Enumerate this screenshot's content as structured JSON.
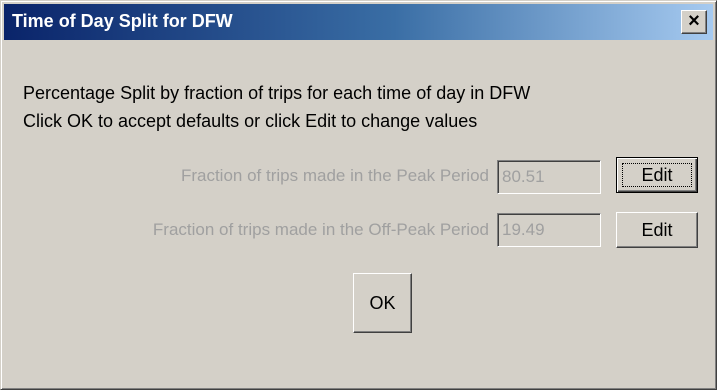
{
  "window": {
    "title": "Time of Day Split for DFW",
    "close_glyph": "✕"
  },
  "description": {
    "line1": "Percentage Split by fraction of trips for each time of day in DFW",
    "line2": "Click OK to accept defaults or click Edit to change values"
  },
  "fields": [
    {
      "label": "Fraction of trips made in the Peak Period",
      "value": "80.51",
      "edit_label": "Edit"
    },
    {
      "label": "Fraction of trips made in the Off-Peak Period",
      "value": "19.49",
      "edit_label": "Edit"
    }
  ],
  "buttons": {
    "ok_label": "OK"
  },
  "colors": {
    "titlebar_start": "#0a246a",
    "titlebar_end": "#a6caf0",
    "dialog_bg": "#d4d0c8",
    "disabled_text": "#a0a0a0"
  }
}
